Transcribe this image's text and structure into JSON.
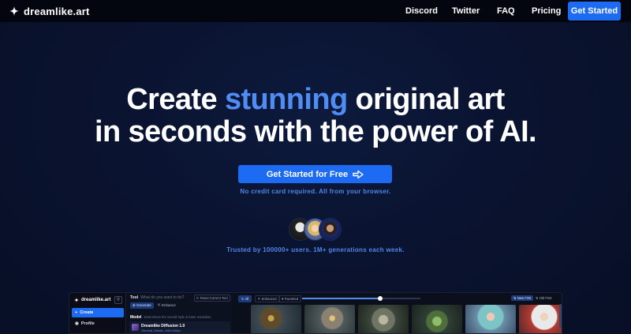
{
  "nav": {
    "brand": "dreamlike.art",
    "links": [
      "Discord",
      "Twitter",
      "FAQ",
      "Pricing"
    ],
    "cta": "Get Started"
  },
  "hero": {
    "headline_pre": "Create ",
    "headline_accent": "stunning",
    "headline_post": " original art",
    "headline_line2": "in seconds with the power of AI.",
    "cta": "Get Started for Free",
    "subtext": "No credit card required. All from your browser.",
    "trust": "Trusted by 100000+ users. 1M+ generations each week."
  },
  "preview": {
    "brand": "dreamlike.art",
    "sidebar": {
      "create": "Create",
      "profile": "Profile"
    },
    "tool": {
      "label": "Tool",
      "question": "What do you want to do?",
      "reset": "Reset Current Tool",
      "generate": "Generate",
      "enhance": "Enhance"
    },
    "model": {
      "label": "Model",
      "description": "Determines the overall style & base resolution",
      "name": "Dreamlike Diffusion 1.0",
      "sub": "General, Artistic, 640×640px"
    },
    "filters": {
      "all": "All",
      "enhanced": "Enhanced",
      "favorited": "Favorited"
    },
    "sort": {
      "new_first": "New First",
      "old_first": "Old First"
    },
    "thumb_size_fraction": 0.66
  },
  "colors": {
    "accent": "#1c6bf2",
    "accent_text": "#4f8df5",
    "nav_bg": "#03060f",
    "page_bg": "#0a1330"
  }
}
